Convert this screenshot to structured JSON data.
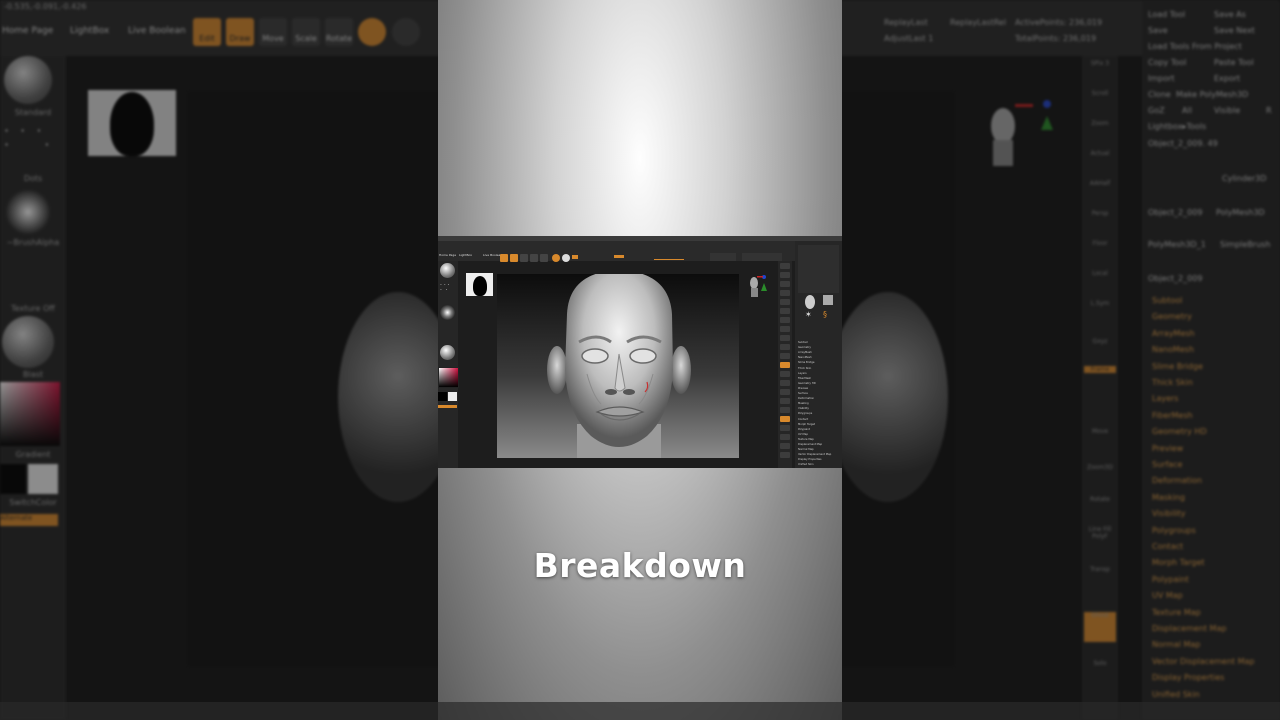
{
  "caption": "Breakdown",
  "background_ui": {
    "coords": "-0.535,-0.091,-0.426",
    "menu": [
      "Home Page",
      "LightBox",
      "Live Boolean"
    ],
    "top_buttons": [
      "Edit",
      "Draw",
      "Move",
      "Scale",
      "Rotate"
    ],
    "replay": [
      "ReplayLast",
      "ReplayLastRel"
    ],
    "adjust": "AdjustLast 1",
    "active_points": "ActivePoints: 236,019",
    "total_points": "TotalPoints: 236,019",
    "left_labels": [
      "Standard",
      "Dots",
      "~BrushAlpha",
      "Texture Off",
      "Blast",
      "Gradient",
      "SwitchColor",
      "Alternate"
    ],
    "right_buttons": [
      "SPix 3",
      "Scroll",
      "Zoom",
      "Actual",
      "AAHalf",
      "Persp",
      "Floor",
      "Local",
      "L.Sym",
      "Gxyz",
      "Frame",
      "Move",
      "Zoom3D",
      "Rotate",
      "Line Fill PolyF",
      "Transp",
      "Ghost",
      "Solo"
    ],
    "tool_buttons": [
      [
        "Load Tool",
        "Save As"
      ],
      [
        "Save",
        "Save Next"
      ],
      [
        "Load Tools From Project",
        ""
      ],
      [
        "Copy Tool",
        "Paste Tool"
      ],
      [
        "Import",
        "Export"
      ],
      [
        "Clone",
        "Make PolyMesh3D"
      ],
      [
        "GoZ",
        "All",
        "Visible",
        "R"
      ],
      [
        "Lightbox▸Tools",
        ""
      ]
    ],
    "object_name": "Object_2_009. 49",
    "tool_thumbs": [
      "Object_2_009",
      "Cylinder3D",
      "PolyMesh3D",
      "PolyMesh3D_1",
      "SimpleBrush",
      "Object_2_009"
    ],
    "tool_menu": [
      "Subtool",
      "Geometry",
      "ArrayMesh",
      "NanoMesh",
      "Slime Bridge",
      "Thick Skin",
      "Layers",
      "FiberMesh",
      "Geometry HD",
      "Preview",
      "Surface",
      "Deformation",
      "Masking",
      "Visibility",
      "Polygroups",
      "Contact",
      "Morph Target",
      "Polypaint",
      "UV Map",
      "Texture Map",
      "Displacement Map",
      "Normal Map",
      "Vector Displacement Map",
      "Display Properties",
      "Unified Skin"
    ]
  },
  "screenshot": {
    "menu": [
      "Home Page",
      "LightBox",
      "Live Boolean"
    ],
    "tool_menu": [
      "Subtool",
      "Geometry",
      "ArrayMesh",
      "NanoMesh",
      "Slime Bridge",
      "Thick Skin",
      "Layers",
      "FiberMesh",
      "Geometry HD",
      "Preview",
      "Surface",
      "Deformation",
      "Masking",
      "Visibility",
      "Polygroups",
      "Contact",
      "Morph Target",
      "Polypaint",
      "UV Map",
      "Texture Map",
      "Displacement Map",
      "Normal Map",
      "Vector Displacement Map",
      "Display Properties",
      "Unified Skin"
    ]
  },
  "colors": {
    "accent": "#d8892c",
    "panel": "#262626",
    "caption": "#ffffff"
  }
}
